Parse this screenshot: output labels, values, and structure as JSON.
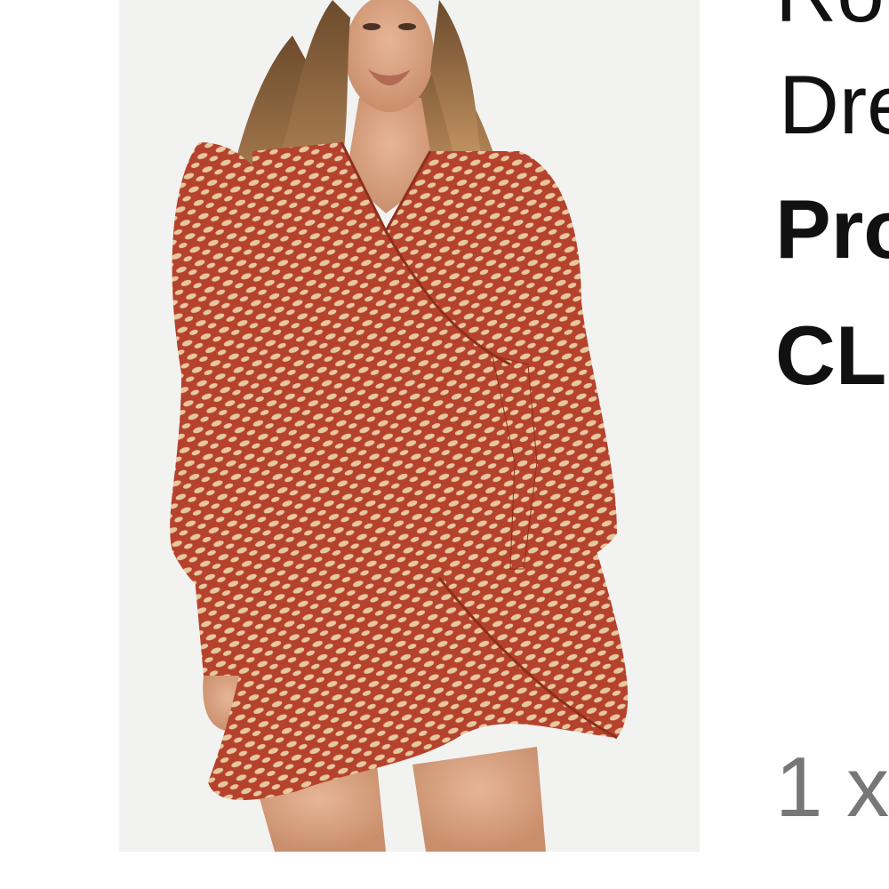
{
  "product": {
    "image_alt": "Model wearing a red and cream printed long-sleeve wrap mini dress",
    "title_line1": "Ro",
    "title_line2": "Dre",
    "meta_line1": "Pro",
    "meta_line2": "CL",
    "quantity": "1 x"
  },
  "colors": {
    "background": "#ffffff",
    "dress_red": "#b5422c",
    "dress_cream": "#e6c79f",
    "text": "#111111",
    "quantity_text": "#777777"
  }
}
